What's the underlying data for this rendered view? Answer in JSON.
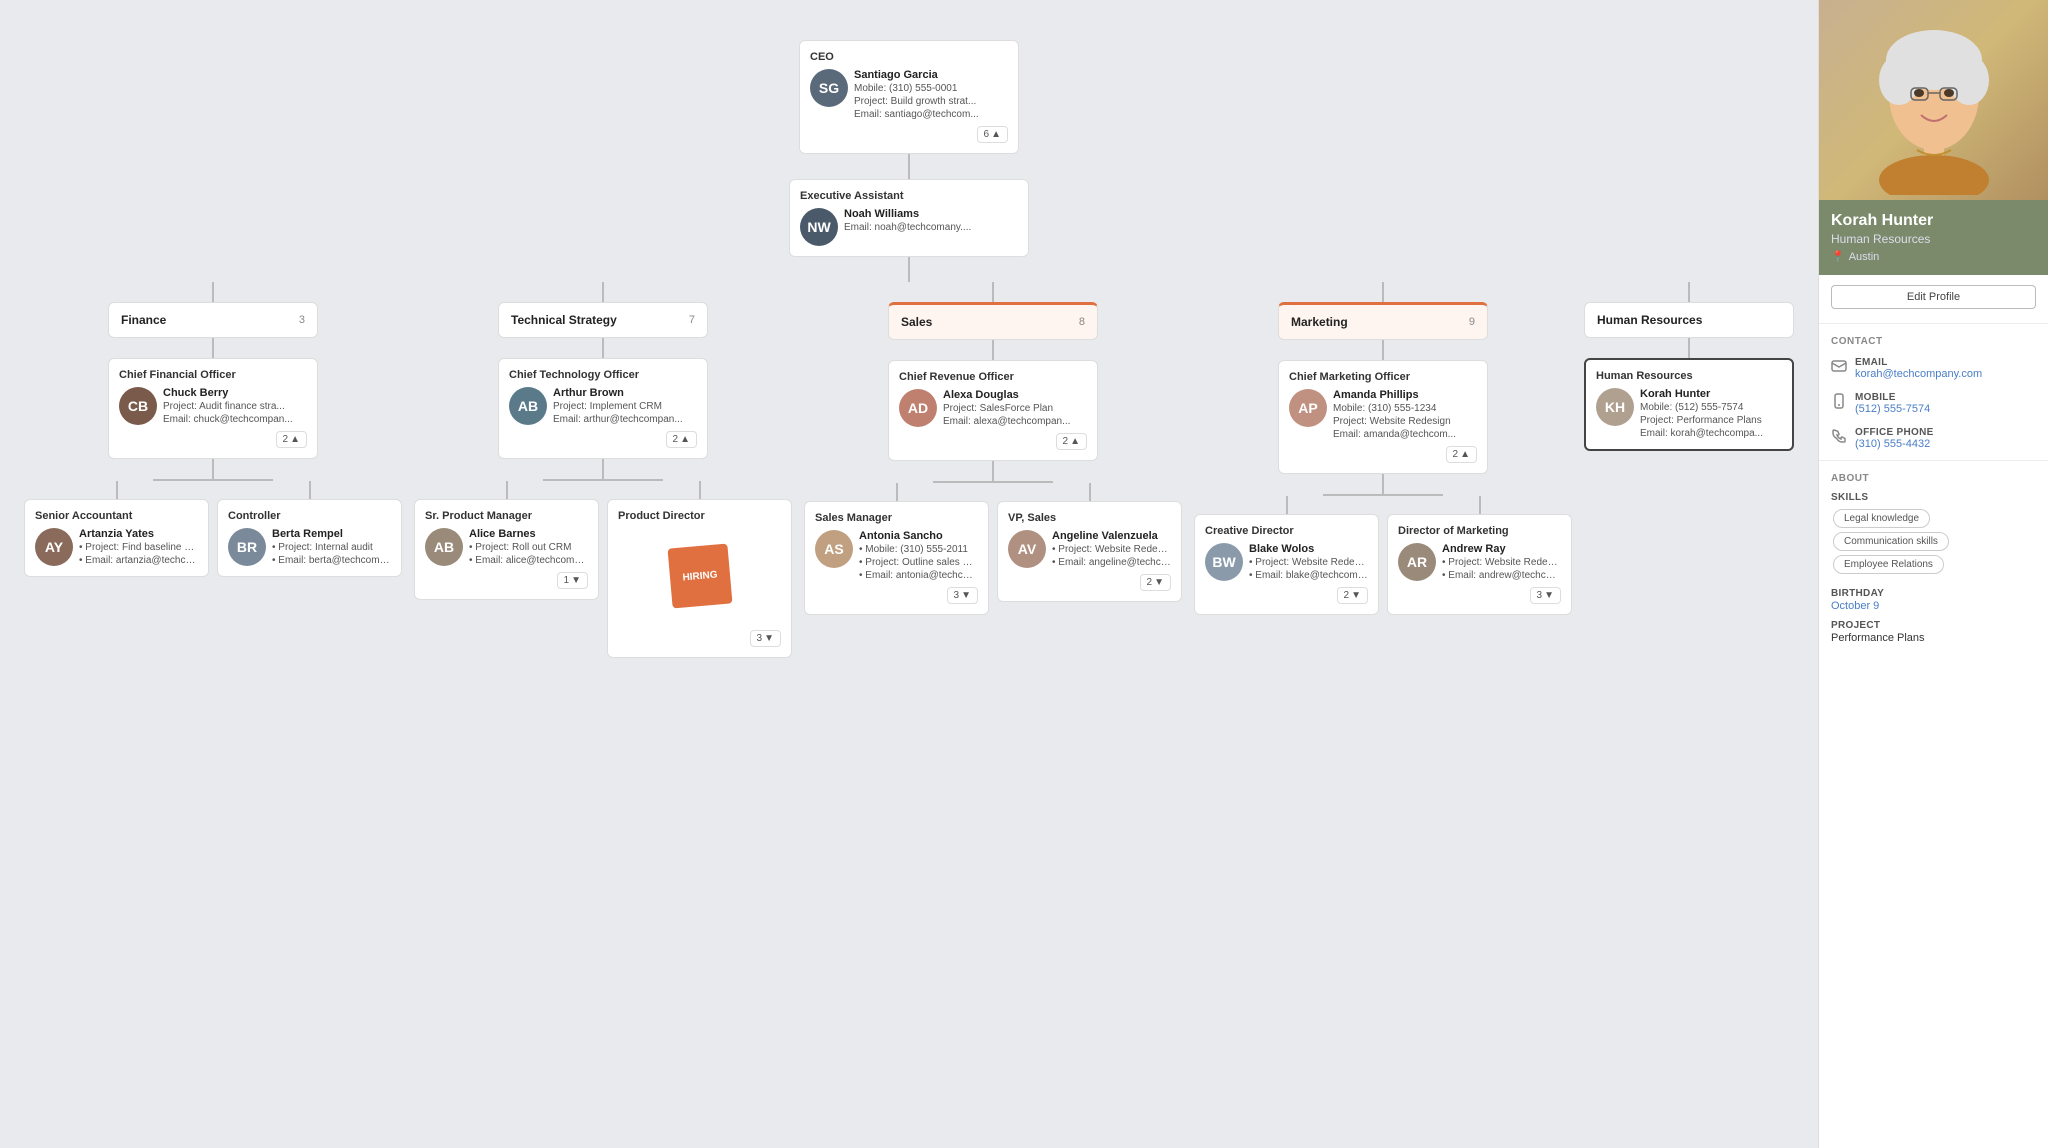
{
  "ceo": {
    "title": "CEO",
    "name": "Santiago Garcia",
    "mobile": "Mobile: (310) 555-0001",
    "project": "Project: Build growth strat...",
    "email": "Email: santiago@techcom...",
    "count": "6",
    "avatar_color": "#5a6a7a"
  },
  "exec_assistant": {
    "title": "Executive Assistant",
    "name": "Noah Williams",
    "email": "Email: noah@techcomany....",
    "avatar_color": "#4a5a6a"
  },
  "departments": [
    {
      "id": "finance",
      "name": "Finance",
      "count": "3"
    },
    {
      "id": "tech",
      "name": "Technical Strategy",
      "count": "7"
    },
    {
      "id": "sales",
      "name": "Sales",
      "count": "8",
      "highlight": true
    },
    {
      "id": "marketing",
      "name": "Marketing",
      "count": "9",
      "highlight": true
    },
    {
      "id": "hr",
      "name": "Human Resources",
      "selected": true
    }
  ],
  "dept_heads": [
    {
      "dept": "finance",
      "title": "Chief Financial Officer",
      "name": "Chuck Berry",
      "project": "Project: Audit finance stra...",
      "email": "Email: chuck@techcompan...",
      "count": "2",
      "avatar_color": "#7a5a4a"
    },
    {
      "dept": "tech",
      "title": "Chief Technology Officer",
      "name": "Arthur Brown",
      "project": "Project: Implement CRM",
      "email": "Email: arthur@techcompan...",
      "count": "2",
      "avatar_color": "#5a7a8a"
    },
    {
      "dept": "sales",
      "title": "Chief Revenue Officer",
      "name": "Alexa Douglas",
      "project": "Project: SalesForce Plan",
      "email": "Email: alexa@techcompan...",
      "count": "2",
      "avatar_color": "#c08070"
    },
    {
      "dept": "marketing",
      "title": "Chief Marketing Officer",
      "name": "Amanda Phillips",
      "mobile": "Mobile: (310) 555-1234",
      "project": "Project: Website Redesign",
      "email": "Email: amanda@techcom...",
      "count": "2",
      "avatar_color": "#c09080"
    },
    {
      "dept": "hr",
      "title": "Human Resources",
      "name": "Korah Hunter",
      "mobile": "Mobile: (512) 555-7574",
      "project": "Project: Performance Plans",
      "email": "Email: korah@techcompa...",
      "selected": true,
      "avatar_color": "#b0a090"
    }
  ],
  "level3": [
    {
      "parent": "finance",
      "cards": [
        {
          "title": "Senior Accountant",
          "name": "Artanzia Yates",
          "project": "Project: Find baseline bud...",
          "email": "Email: artanzia@techcom...",
          "avatar_color": "#8a6a5a"
        },
        {
          "title": "Controller",
          "name": "Berta Rempel",
          "project": "Project: Internal audit",
          "email": "Email: berta@techcompany...",
          "avatar_color": "#7a8a9a"
        }
      ]
    },
    {
      "parent": "tech",
      "cards": [
        {
          "title": "Sr. Product Manager",
          "name": "Alice Barnes",
          "project": "Project: Roll out CRM",
          "email": "Email: alice@techcompan...",
          "count": "1",
          "avatar_color": "#9a8a7a"
        },
        {
          "title": "Product Director",
          "hiring": true,
          "count": "3"
        }
      ]
    },
    {
      "parent": "sales",
      "cards": [
        {
          "title": "Sales Manager",
          "name": "Antonia Sancho",
          "mobile": "Mobile: (310) 555-2011",
          "project": "Project: Outline sales proc...",
          "email": "Email: antonia@techcomp...",
          "count": "3",
          "avatar_color": "#c0a080"
        },
        {
          "title": "VP, Sales",
          "name": "Angeline Valenzuela",
          "project": "Project: Website Redesign",
          "email": "Email: angeline@techcom...",
          "count": "2",
          "avatar_color": "#b09080"
        }
      ]
    },
    {
      "parent": "marketing",
      "cards": [
        {
          "title": "Creative Director",
          "name": "Blake Wolos",
          "project": "Project: Website Redesign",
          "email": "Email: blake@techcompan...",
          "count": "2",
          "avatar_color": "#8a9aaa"
        },
        {
          "title": "Director of Marketing",
          "name": "Andrew Ray",
          "project": "Project: Website Redesign",
          "email": "Email: andrew@techcom...",
          "count": "3",
          "avatar_color": "#9a8a7a"
        }
      ]
    }
  ],
  "right_panel": {
    "name": "Korah Hunter",
    "department": "Human Resources",
    "location": "Austin",
    "edit_btn": "Edit Profile",
    "contact_label": "CONTACT",
    "email_label": "EMAIL",
    "email_value": "korah@techcompany.com",
    "mobile_label": "MOBILE",
    "mobile_value": "(512) 555-7574",
    "office_label": "OFFICE PHONE",
    "office_value": "(310) 555-4432",
    "about_label": "ABOUT",
    "skills_label": "SKILLS",
    "skills": [
      "Legal knowledge",
      "Communication skills",
      "Employee Relations"
    ],
    "birthday_label": "BIRTHDAY",
    "birthday_value": "October 9",
    "project_label": "PROJECT",
    "project_value": "Performance Plans"
  }
}
